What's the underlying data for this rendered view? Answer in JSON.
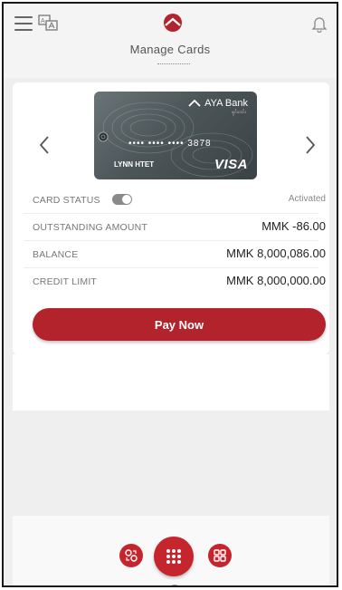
{
  "header": {
    "title": "Manage Cards",
    "icons": [
      "menu-icon",
      "language-icon",
      "aya-logo-icon",
      "bell-icon"
    ]
  },
  "card": {
    "bank_name": "AYA Bank",
    "bank_sub": "ရှင်းလင်း",
    "number_masked": "•••• •••• ••••  3878",
    "holder": "LYNN HTET",
    "network": "VISA"
  },
  "details": {
    "card_status_label": "CARD STATUS",
    "card_status_value": "Activated",
    "outstanding_label": "OUTSTANDING AMOUNT",
    "outstanding_value": "MMK -86.00",
    "balance_label": "BALANCE",
    "balance_value": "MMK 8,000,086.00",
    "credit_limit_label": "CREDIT LIMIT",
    "credit_limit_value": "MMK 8,000,000.00"
  },
  "actions": {
    "pay_now": "Pay Now"
  },
  "colors": {
    "accent": "#b3232b",
    "nav": "#c5262e",
    "background": "#efefef"
  }
}
